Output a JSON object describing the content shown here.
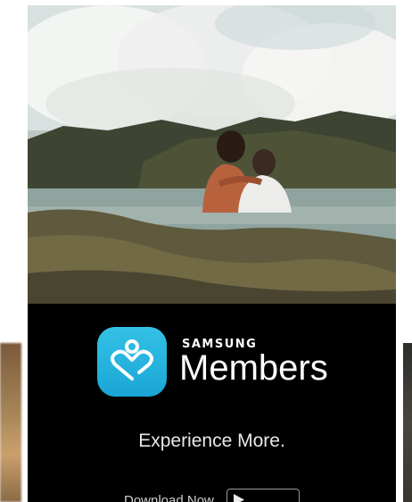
{
  "ad": {
    "brand": "SAMSUNG",
    "app_name": "Members",
    "tagline": "Experience More.",
    "download_label": "Download Now",
    "store_badge_icon": "google-play-icon",
    "app_icon": "samsung-members-heart-icon",
    "photo_subject": "couple-in-ocean-photo"
  },
  "colors": {
    "icon_blue": "#1aa6d6",
    "background": "#000000",
    "text": "#ffffff"
  }
}
